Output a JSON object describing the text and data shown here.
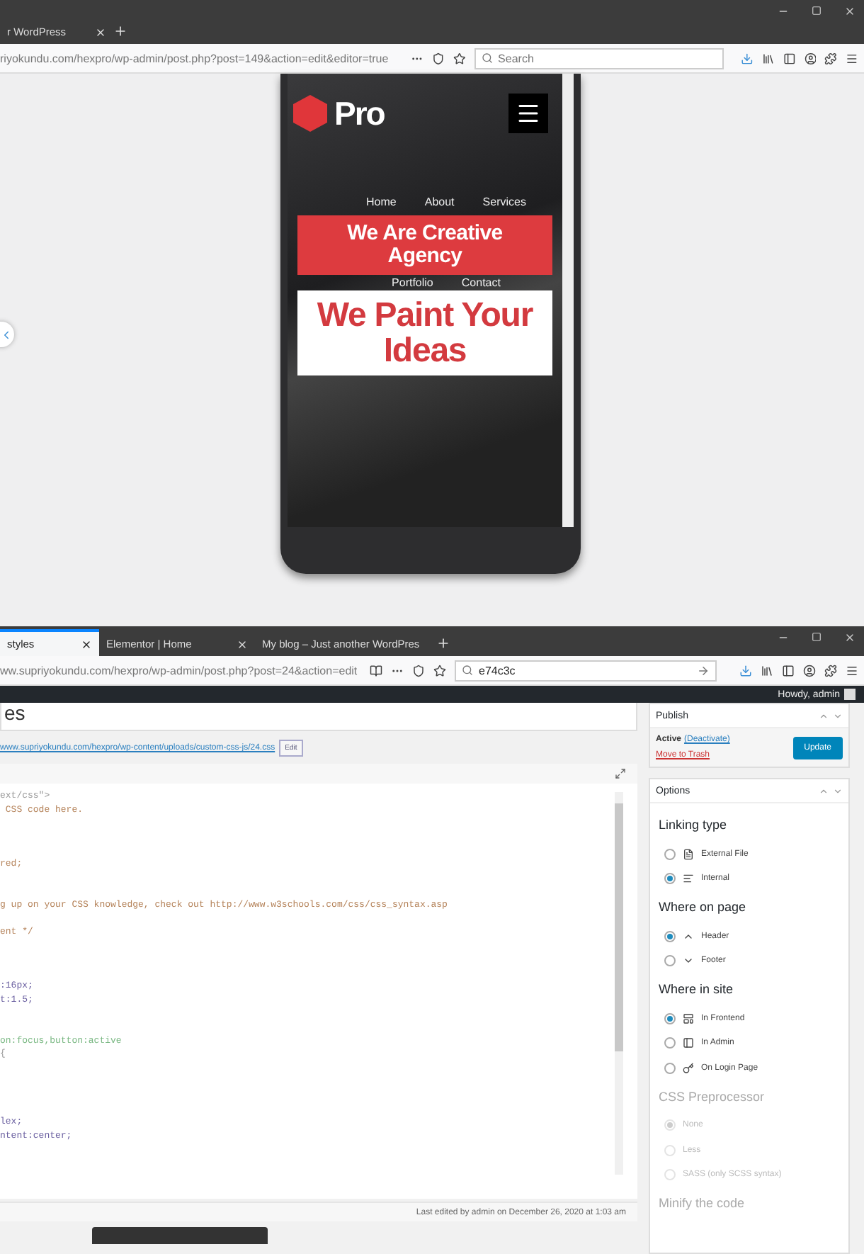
{
  "top_browser": {
    "tab": "r WordPress",
    "url": "riyokundu.com/hexpro/wp-admin/post.php?post=149&action=edit&editor=true",
    "search": {
      "placeholder": "Search"
    }
  },
  "phone_preview": {
    "logo": "Pro",
    "nav_top": [
      "Home",
      "About",
      "Services"
    ],
    "banner": "We Are Creative Agency",
    "nav_bottom": [
      "Portfolio",
      "Contact"
    ],
    "headline": "We Paint Your Ideas"
  },
  "bottom_browser": {
    "tabs": [
      {
        "label": "styles",
        "selected": true
      },
      {
        "label": "Elementor | Home",
        "selected": false
      },
      {
        "label": "My blog – Just another WordPres",
        "selected": false
      }
    ],
    "url": "ww.supriyokundu.com/hexpro/wp-admin/post.php?post=24&action=edit",
    "search": {
      "value": "e74c3c"
    }
  },
  "admin_bar": {
    "greeting": "Howdy, admin"
  },
  "editor": {
    "title": "es",
    "file_link": "www.supriyokundu.com/hexpro/wp-content/uploads/custom-css-js/24.css",
    "edit_button": "Edit",
    "code_lines": [
      {
        "kind": "tag",
        "text": "ext/css\">"
      },
      {
        "kind": "comment",
        "text": " CSS code here."
      },
      {
        "kind": "blank"
      },
      {
        "kind": "blank"
      },
      {
        "kind": "blank"
      },
      {
        "kind": "comment",
        "text": "red;"
      },
      {
        "kind": "blank"
      },
      {
        "kind": "blank"
      },
      {
        "kind": "comment",
        "text": "g up on your CSS knowledge, check out http://www.w3schools.com/css/css_syntax.asp"
      },
      {
        "kind": "blank"
      },
      {
        "kind": "comment",
        "text": "ent */"
      },
      {
        "kind": "blank"
      },
      {
        "kind": "blank"
      },
      {
        "kind": "blank"
      },
      {
        "kind": "value",
        "text": ":16px;"
      },
      {
        "kind": "value",
        "text": "t:1.5;"
      },
      {
        "kind": "blank"
      },
      {
        "kind": "blank"
      },
      {
        "kind": "selector",
        "text": "on:focus,button:active"
      },
      {
        "kind": "tag",
        "text": "{"
      },
      {
        "kind": "blank"
      },
      {
        "kind": "blank"
      },
      {
        "kind": "blank"
      },
      {
        "kind": "blank"
      },
      {
        "kind": "value",
        "text": "lex;"
      },
      {
        "kind": "value",
        "text": "ntent:center;"
      }
    ],
    "status": "Last edited by admin on December 26, 2020 at 1:03 am"
  },
  "publish": {
    "title": "Publish",
    "status": "Active",
    "deactivate_link": "(Deactivate)",
    "trash_link": "Move to Trash",
    "update_button": "Update"
  },
  "options": {
    "title": "Options",
    "groups": [
      {
        "heading": "Linking type",
        "disabled": false,
        "options": [
          {
            "label": "External File",
            "selected": false
          },
          {
            "label": "Internal",
            "selected": true
          }
        ]
      },
      {
        "heading": "Where on page",
        "disabled": false,
        "options": [
          {
            "label": "Header",
            "selected": true
          },
          {
            "label": "Footer",
            "selected": false
          }
        ]
      },
      {
        "heading": "Where in site",
        "disabled": false,
        "options": [
          {
            "label": "In Frontend",
            "selected": true
          },
          {
            "label": "In Admin",
            "selected": false
          },
          {
            "label": "On Login Page",
            "selected": false
          }
        ]
      },
      {
        "heading": "CSS Preprocessor",
        "disabled": true,
        "options": [
          {
            "label": "None",
            "selected": true
          },
          {
            "label": "Less",
            "selected": false
          },
          {
            "label": "SASS (only SCSS syntax)",
            "selected": false
          }
        ]
      }
    ],
    "minify_heading": "Minify the code"
  }
}
